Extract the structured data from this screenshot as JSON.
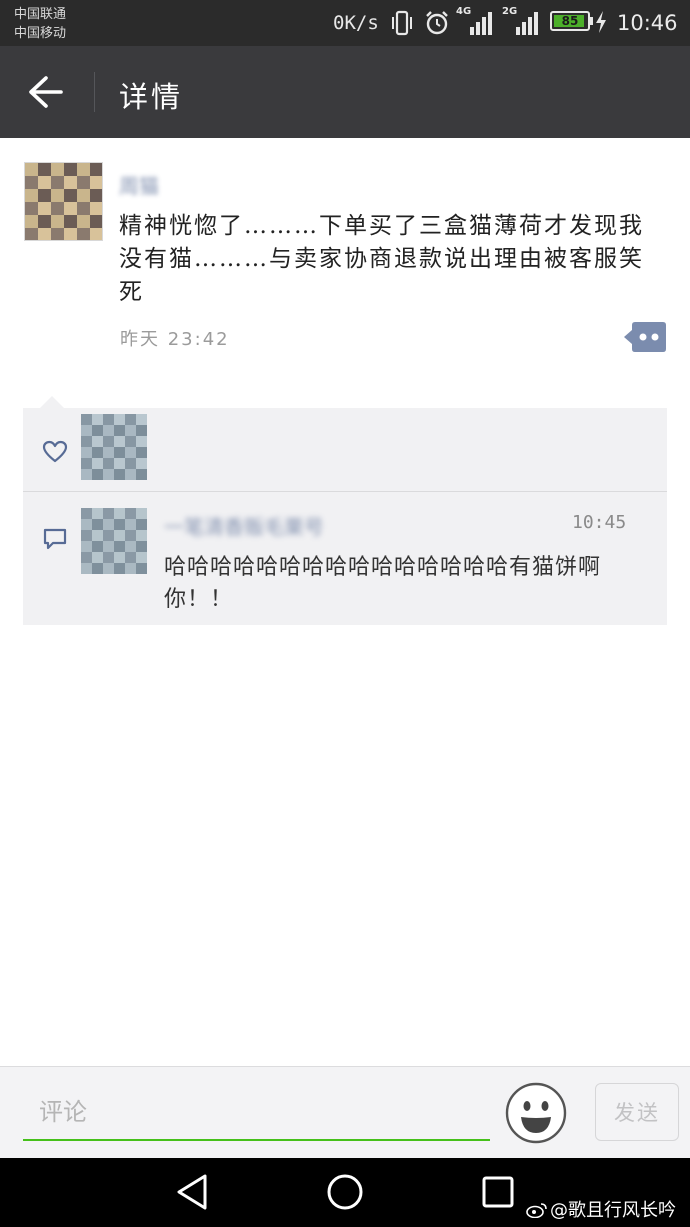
{
  "status_bar": {
    "carrier_1": "中国联通",
    "carrier_2": "中国移动",
    "net_speed": "0K/s",
    "network_1": "4G",
    "network_2": "2G",
    "battery_level": "85",
    "time": "10:46",
    "icons": [
      "vibrate-icon",
      "alarm-icon",
      "signal-4g-icon",
      "signal-2g-icon",
      "battery-icon",
      "charging-icon"
    ]
  },
  "header": {
    "back_icon": "back-arrow-icon",
    "title": "详情"
  },
  "post": {
    "author": "周猫",
    "text": "精神恍惚了………下单买了三盒猫薄荷才发现我没有猫………与卖家协商退款说出理由被客服笑死",
    "time": "昨天 23:42",
    "more_icon": "comment-menu-icon"
  },
  "likes": {
    "icon": "heart-icon"
  },
  "comments": [
    {
      "author": "一笔清香贩毛栗号",
      "time": "10:45",
      "text": "哈哈哈哈哈哈哈哈哈哈哈哈哈哈哈有猫饼啊你！！"
    }
  ],
  "input_bar": {
    "placeholder": "评论",
    "emoji_icon": "emoji-smile-icon",
    "send_label": "发送"
  },
  "nav_bar": {
    "icons": [
      "nav-back-icon",
      "nav-home-icon",
      "nav-recent-apps-icon"
    ]
  },
  "watermark": "@歌且行风长吟"
}
